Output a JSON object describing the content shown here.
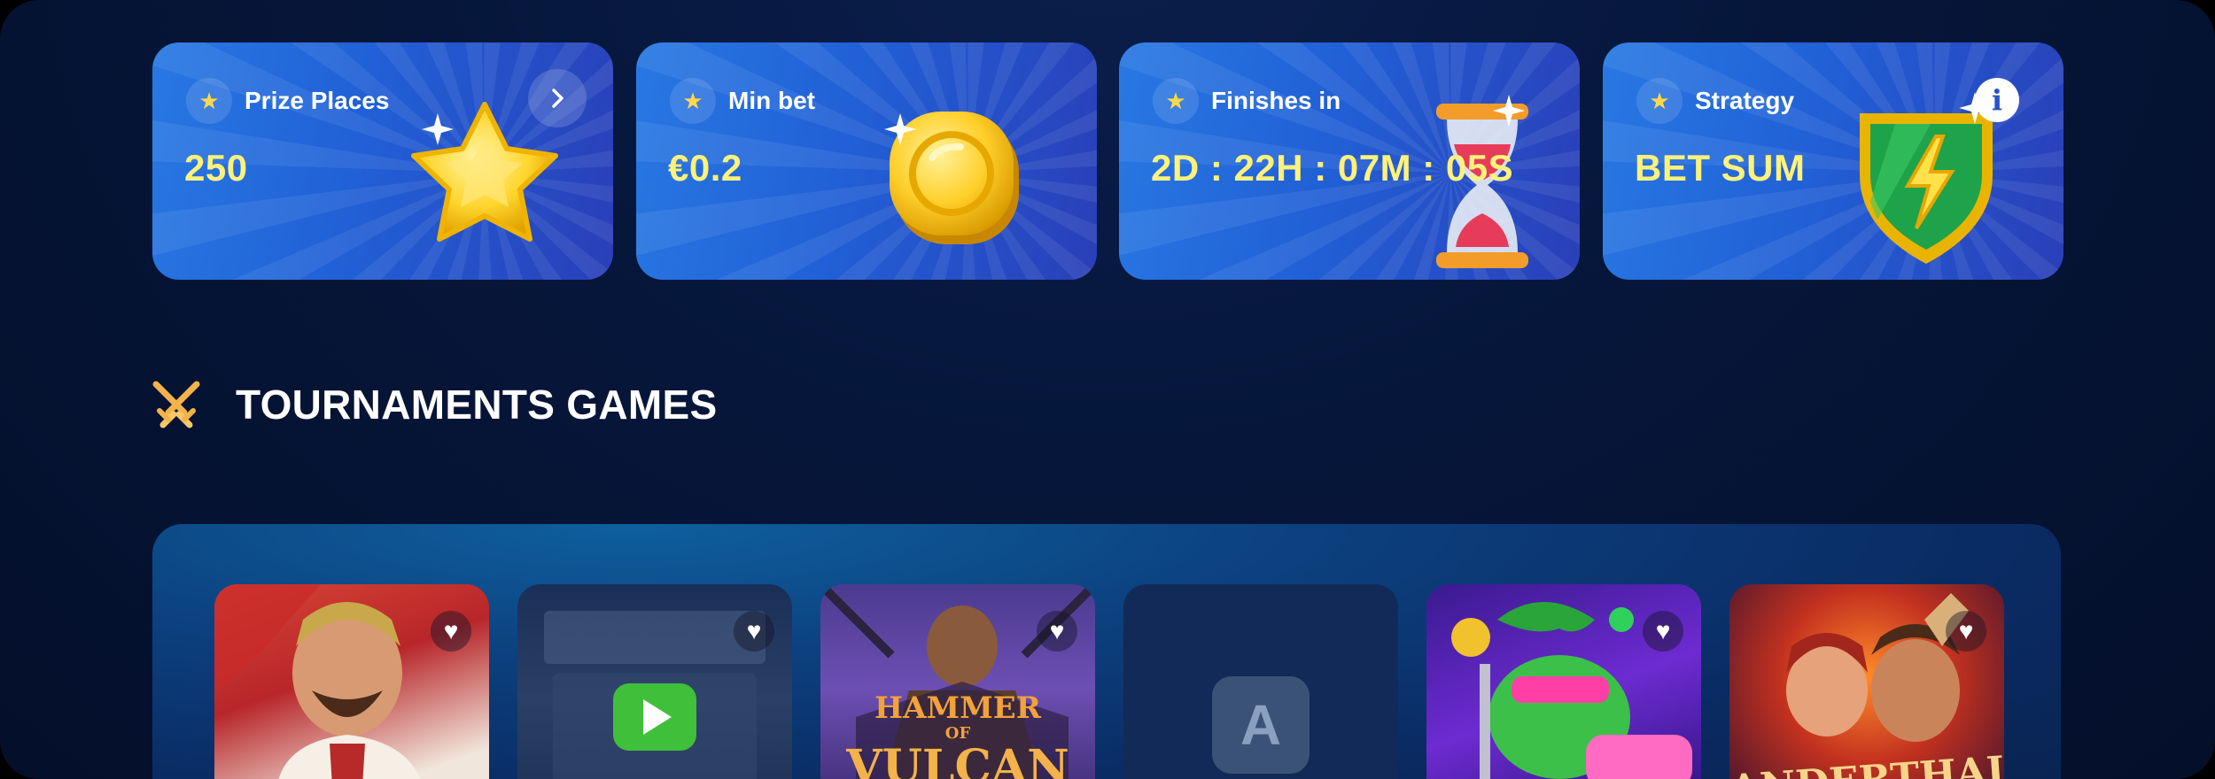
{
  "cards": [
    {
      "label": "Prize Places",
      "value": "250",
      "art": "star-art",
      "action": "chevron-right-icon"
    },
    {
      "label": "Min bet",
      "value": "€0.2",
      "art": "coin-art"
    },
    {
      "label": "Finishes in",
      "value": "2D : 22H : 07M : 05S",
      "art": "hourglass-art"
    },
    {
      "label": "Strategy",
      "value": "BET SUM",
      "art": "lightning-shield-art",
      "action": "info-icon",
      "action_text": "i"
    }
  ],
  "section": {
    "title": "TOURNAMENTS GAMES",
    "icon": "crossed-swords-icon"
  },
  "games": [
    {
      "name": "king-portrait-game",
      "favorite_icon": "heart-icon"
    },
    {
      "name": "western-play-game",
      "favorite_icon": "heart-icon",
      "overlay": "play-icon"
    },
    {
      "name": "hammer-of-vulcan-game",
      "logo_line1": "HAMMER",
      "logo_line2": "OF",
      "logo_line3": "VULCAN",
      "favorite_icon": "heart-icon"
    },
    {
      "name": "placeholder-game",
      "letter": "A"
    },
    {
      "name": "frog-casino-game",
      "favorite_icon": "heart-icon"
    },
    {
      "name": "caveman-game",
      "logo_text": "ANDERTHALS",
      "favorite_icon": "heart-icon"
    }
  ],
  "colors": {
    "value_yellow": "#fff27a",
    "card_blue": "#2160d6",
    "background": "#06163a",
    "heart_white": "#ffffff"
  }
}
